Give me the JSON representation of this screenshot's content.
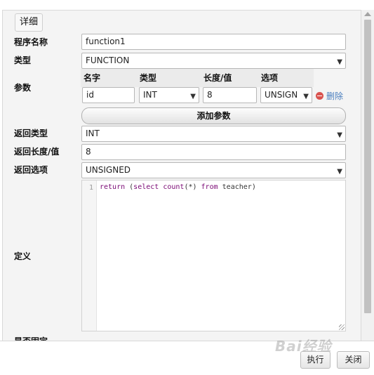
{
  "dialog": {
    "legend": "详细"
  },
  "labels": {
    "name": "程序名称",
    "type": "类型",
    "params": "参数",
    "return_type": "返回类型",
    "return_length": "返回长度/值",
    "return_options": "返回选项",
    "definition": "定义",
    "cut_off": "是否固定"
  },
  "fields": {
    "name": "function1",
    "type": "FUNCTION",
    "return_type": "INT",
    "return_length": "8",
    "return_options": "UNSIGNED"
  },
  "params_table": {
    "headers": [
      "名字",
      "类型",
      "长度/值",
      "选项"
    ],
    "rows": [
      {
        "name": "id",
        "type": "INT",
        "length": "8",
        "option": "UNSIGN"
      }
    ],
    "delete_label": "删除",
    "add_label": "添加参数"
  },
  "editor": {
    "lines": [
      {
        "no": "1",
        "text": "return (select count(*) from teacher)"
      }
    ]
  },
  "footer": {
    "execute_label": "执行",
    "close_label": "关闭"
  },
  "watermark": "Bai经验"
}
